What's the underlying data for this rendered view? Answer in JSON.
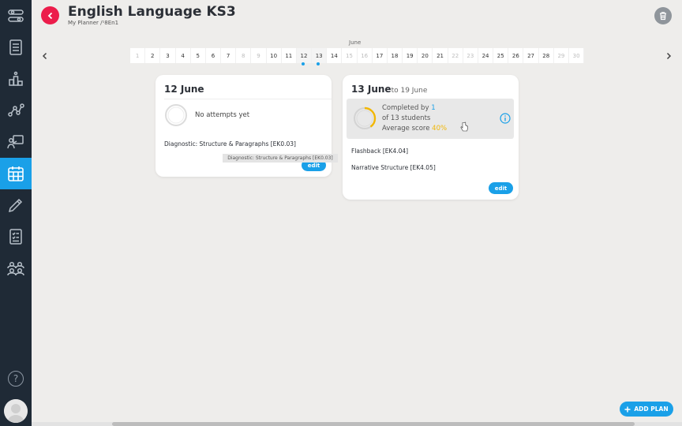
{
  "header": {
    "title": "English Language KS3",
    "breadcrumb": "My Planner /¹8En1"
  },
  "sidebar": {
    "items": [
      {
        "name": "sliders-icon"
      },
      {
        "name": "list-icon"
      },
      {
        "name": "podium-icon"
      },
      {
        "name": "network-icon"
      },
      {
        "name": "presentation-icon"
      },
      {
        "name": "calendar-icon",
        "active": true
      },
      {
        "name": "pencil-icon"
      },
      {
        "name": "checklist-icon"
      },
      {
        "name": "group-icon"
      }
    ],
    "help_label": "?"
  },
  "datestrip": {
    "month": "June",
    "days": [
      "1",
      "2",
      "3",
      "4",
      "5",
      "6",
      "7",
      "8",
      "9",
      "10",
      "11",
      "12",
      "13",
      "14",
      "15",
      "16",
      "17",
      "18",
      "19",
      "20",
      "21",
      "22",
      "23",
      "24",
      "25",
      "26",
      "27",
      "28",
      "29",
      "30"
    ],
    "weekend_days": [
      "1",
      "8",
      "9",
      "15",
      "16",
      "22",
      "23",
      "29",
      "30"
    ],
    "selected_days": [
      "12",
      "13"
    ]
  },
  "card1": {
    "date": "12 June",
    "status": "No attempts yet",
    "lesson": "Diagnostic: Structure & Paragraphs [EK0.03]",
    "edit_label": "edit",
    "tooltip": "Diagnostic: Structure & Paragraphs [EK0.03]"
  },
  "card2": {
    "date": "13 June",
    "range": "to 19 June",
    "completed_prefix": "Completed by",
    "completed_count": "1",
    "students_line": "of 13 students",
    "average_prefix": "Average score",
    "average_value": "40%",
    "average_fraction": 0.4,
    "lessons": [
      "Flashback [EK4.04]",
      "Narrative Structure [EK4.05]"
    ],
    "edit_label": "edit"
  },
  "actions": {
    "add_plan_label": "ADD PLAN"
  },
  "colors": {
    "accent": "#1aa0e8",
    "sidebar": "#1f2a36",
    "back_button": "#ec1d4b",
    "score": "#f2b705"
  }
}
